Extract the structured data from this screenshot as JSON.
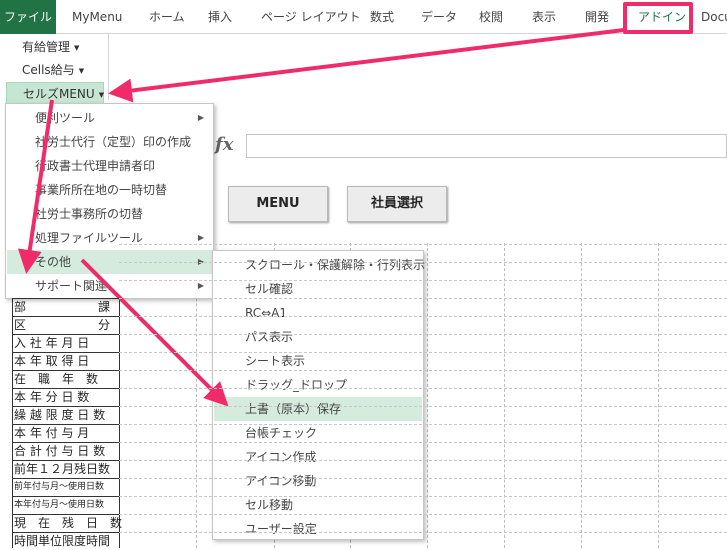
{
  "ribbon": {
    "tabs": [
      "ファイル",
      "MyMenu",
      "ホーム",
      "挿入",
      "ページ レイアウト",
      "数式",
      "データ",
      "校閲",
      "表示",
      "開発",
      "アドイン",
      "Docu"
    ],
    "groups": [
      "有給管理",
      "Cells給与",
      "セルズMENU"
    ]
  },
  "formula": {
    "fx": "fx",
    "value": ""
  },
  "sheet_buttons": {
    "menu": "MENU",
    "employee_select": "社員選択"
  },
  "row_labels": [
    {
      "text": "部　　　　　　課",
      "small": false
    },
    {
      "text": "区　　　　　　分",
      "small": false
    },
    {
      "text": "入 社 年 月 日",
      "small": false
    },
    {
      "text": "本 年 取 得 日",
      "small": false
    },
    {
      "text": "在　職　年　数",
      "small": false
    },
    {
      "text": "本 年 分 日 数",
      "small": false
    },
    {
      "text": "繰 越 限 度 日 数",
      "small": false
    },
    {
      "text": "本 年 付 与 月",
      "small": false
    },
    {
      "text": "合 計 付 与 日 数",
      "small": false
    },
    {
      "text": "前年１２月残日数",
      "small": false
    },
    {
      "text": "前年付与月～使用日数",
      "small": true
    },
    {
      "text": "本年付与月～使用日数",
      "small": true
    },
    {
      "text": "現　在　残　日　数",
      "small": false
    },
    {
      "text": "時間単位限度時間",
      "small": false
    }
  ],
  "menu1": [
    {
      "label": "便利ツール",
      "submenu": true
    },
    {
      "label": "社労士代行（定型）印の作成",
      "submenu": false
    },
    {
      "label": "行政書士代理申請者印",
      "submenu": false
    },
    {
      "label": "事業所所在地の一時切替",
      "submenu": false
    },
    {
      "label": "社労士事務所の切替",
      "submenu": false
    },
    {
      "label": "処理ファイルツール",
      "submenu": true
    },
    {
      "label": "その他",
      "submenu": true
    },
    {
      "label": "サポート関連",
      "submenu": true
    }
  ],
  "menu2": [
    "スクロール・保護解除・行列表示",
    "セル確認",
    "RC⇔A1",
    "パス表示",
    "シート表示",
    "ドラッグ_ドロップ",
    "上書（原本）保存",
    "台帳チェック",
    "アイコン作成",
    "アイコン移動",
    "セル移動",
    "ユーザー設定"
  ],
  "colors": {
    "accent": "#217346",
    "highlight": "#d4ebdd",
    "arrow": "#ef2b6a"
  }
}
